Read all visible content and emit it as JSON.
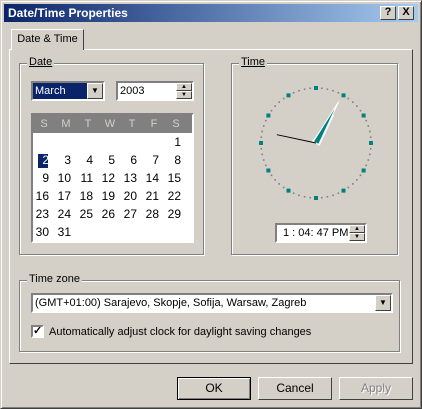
{
  "window": {
    "title": "Date/Time Properties",
    "help_label": "?",
    "close_label": "X"
  },
  "tab": {
    "label": "Date & Time"
  },
  "date": {
    "group_label": "Date",
    "month": "March",
    "year": "2003",
    "weekdays": [
      "S",
      "M",
      "T",
      "W",
      "T",
      "F",
      "S"
    ],
    "days": [
      "1",
      "2",
      "3",
      "4",
      "5",
      "6",
      "7",
      "8",
      "9",
      "10",
      "11",
      "12",
      "13",
      "14",
      "15",
      "16",
      "17",
      "18",
      "19",
      "20",
      "21",
      "22",
      "23",
      "24",
      "25",
      "26",
      "27",
      "28",
      "29",
      "30",
      "31"
    ],
    "selected_day": "2"
  },
  "time": {
    "group_label": "Time",
    "value": "1 : 04: 47 PM",
    "hours": 1,
    "minutes": 4,
    "seconds": 47
  },
  "timezone": {
    "group_label": "Time zone",
    "value": "(GMT+01:00) Sarajevo, Skopje, Sofija, Warsaw, Zagreb",
    "dst_label": "Automatically adjust clock for daylight saving changes",
    "dst_checked": true
  },
  "buttons": {
    "ok": "OK",
    "cancel": "Cancel",
    "apply": "Apply"
  },
  "colors": {
    "title_start": "#0a246a",
    "title_end": "#a6caf0",
    "face": "#d4d0c8",
    "clock_hand": "#008080"
  }
}
